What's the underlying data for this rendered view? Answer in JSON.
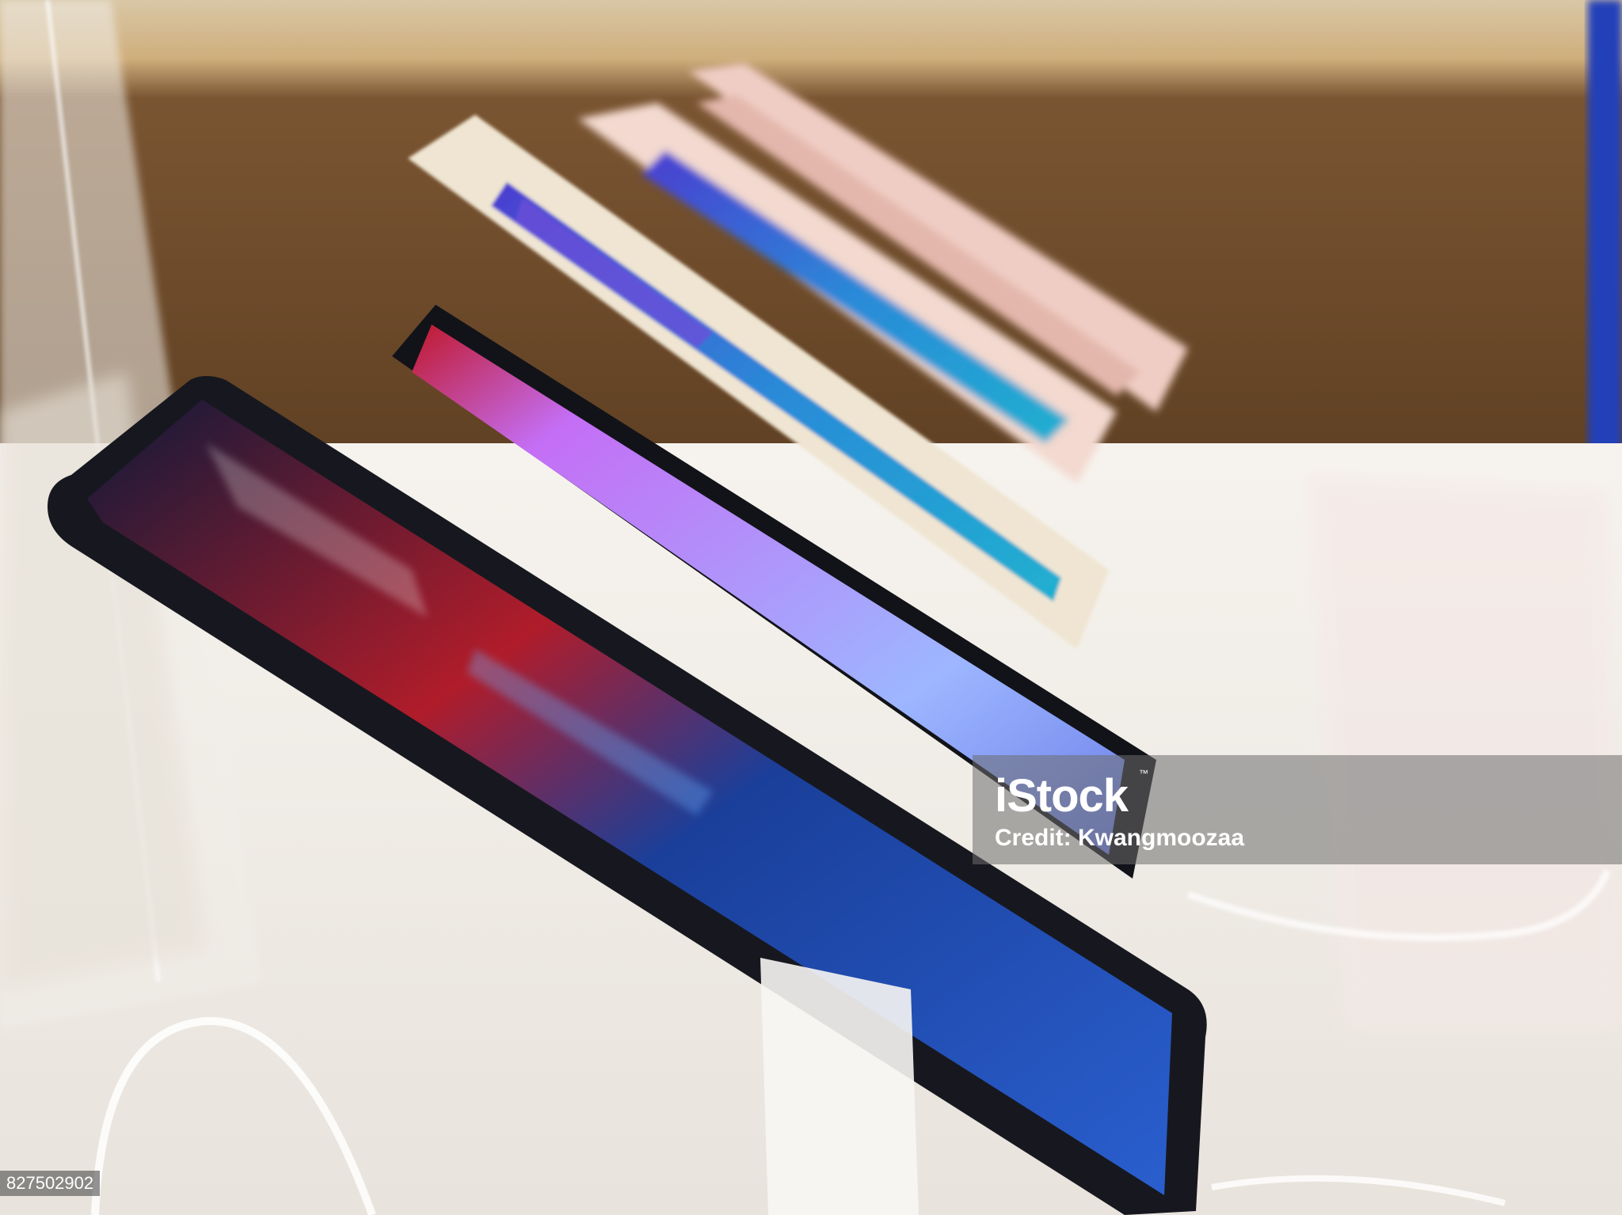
{
  "photo": {
    "subject": "smartphones displayed on security stands in a store"
  },
  "watermark": {
    "brand": "iStock",
    "tm": "™",
    "credit": "Credit: Kwangmoozaa"
  },
  "image_id": "827502902",
  "colors": {
    "wall_brown": "#6b4a2a",
    "table_white": "#f2efea",
    "phone_black": "#15161c",
    "screen_blue": "#1f4fb0",
    "screen_red": "#c0182a",
    "screen_purple": "#b060f0",
    "phone_gold": "#eee3cf",
    "phone_rose": "#f0cdc4"
  }
}
